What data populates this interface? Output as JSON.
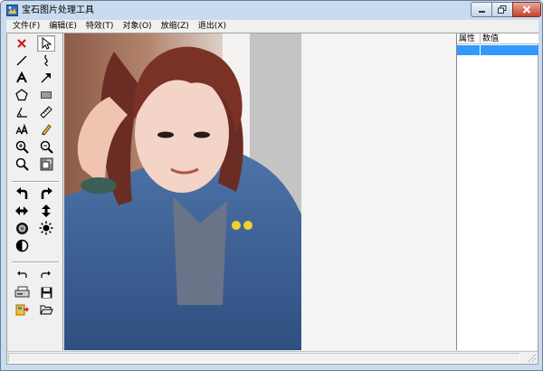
{
  "window": {
    "title": "宝石图片处理工具",
    "controls": {
      "minimize": "minimize",
      "maximize": "maximize",
      "close": "close"
    }
  },
  "menu": [
    {
      "label": "文件(F)"
    },
    {
      "label": "编辑(E)"
    },
    {
      "label": "特效(T)"
    },
    {
      "label": "对象(O)"
    },
    {
      "label": "放缩(Z)"
    },
    {
      "label": "退出(X)"
    }
  ],
  "toolbox": {
    "tools": [
      {
        "name": "delete-tool",
        "icon": "red-x-icon"
      },
      {
        "name": "select-tool",
        "icon": "cursor-arrow-icon",
        "active": true
      },
      {
        "name": "line-tool",
        "icon": "line-icon"
      },
      {
        "name": "curve-tool",
        "icon": "curve-icon"
      },
      {
        "name": "text-tool",
        "icon": "text-a-icon"
      },
      {
        "name": "arrow-tool",
        "icon": "arrow-icon"
      },
      {
        "name": "polygon-tool",
        "icon": "pentagon-icon"
      },
      {
        "name": "rectangle-tool",
        "icon": "rectangle-icon"
      },
      {
        "name": "angle-tool",
        "icon": "angle-icon"
      },
      {
        "name": "ruler-tool",
        "icon": "ruler-icon"
      },
      {
        "name": "font-size-tool",
        "icon": "font-size-icon"
      },
      {
        "name": "pencil-tool",
        "icon": "pencil-icon"
      },
      {
        "name": "zoom-in-tool",
        "icon": "zoom-in-icon"
      },
      {
        "name": "zoom-out-tool",
        "icon": "zoom-out-icon"
      },
      {
        "name": "zoom-fit-tool",
        "icon": "zoom-icon"
      },
      {
        "name": "resize-tool",
        "icon": "resize-image-icon"
      },
      {
        "name": "rotate-left-tool",
        "icon": "rotate-left-icon"
      },
      {
        "name": "rotate-right-tool",
        "icon": "rotate-right-icon"
      },
      {
        "name": "flip-horizontal-tool",
        "icon": "flip-horizontal-icon"
      },
      {
        "name": "flip-vertical-tool",
        "icon": "flip-vertical-icon"
      },
      {
        "name": "blur-tool",
        "icon": "blur-circle-icon"
      },
      {
        "name": "brightness-tool",
        "icon": "sun-icon"
      },
      {
        "name": "contrast-tool",
        "icon": "contrast-icon"
      },
      {
        "name": "undo-tool",
        "icon": "undo-icon"
      },
      {
        "name": "redo-tool",
        "icon": "redo-icon"
      },
      {
        "name": "scanner-tool",
        "icon": "scanner-icon"
      },
      {
        "name": "save-tool",
        "icon": "floppy-save-icon"
      },
      {
        "name": "import-tool",
        "icon": "import-icon"
      },
      {
        "name": "open-tool",
        "icon": "open-folder-icon"
      }
    ]
  },
  "canvas": {
    "image_description_icon": "photo-portrait-icon"
  },
  "properties": {
    "columns": [
      "属性",
      "数值"
    ]
  },
  "colors": {
    "selection": "#3399ff",
    "delete_red": "#d01010",
    "title_bar": "#c9dbef"
  }
}
